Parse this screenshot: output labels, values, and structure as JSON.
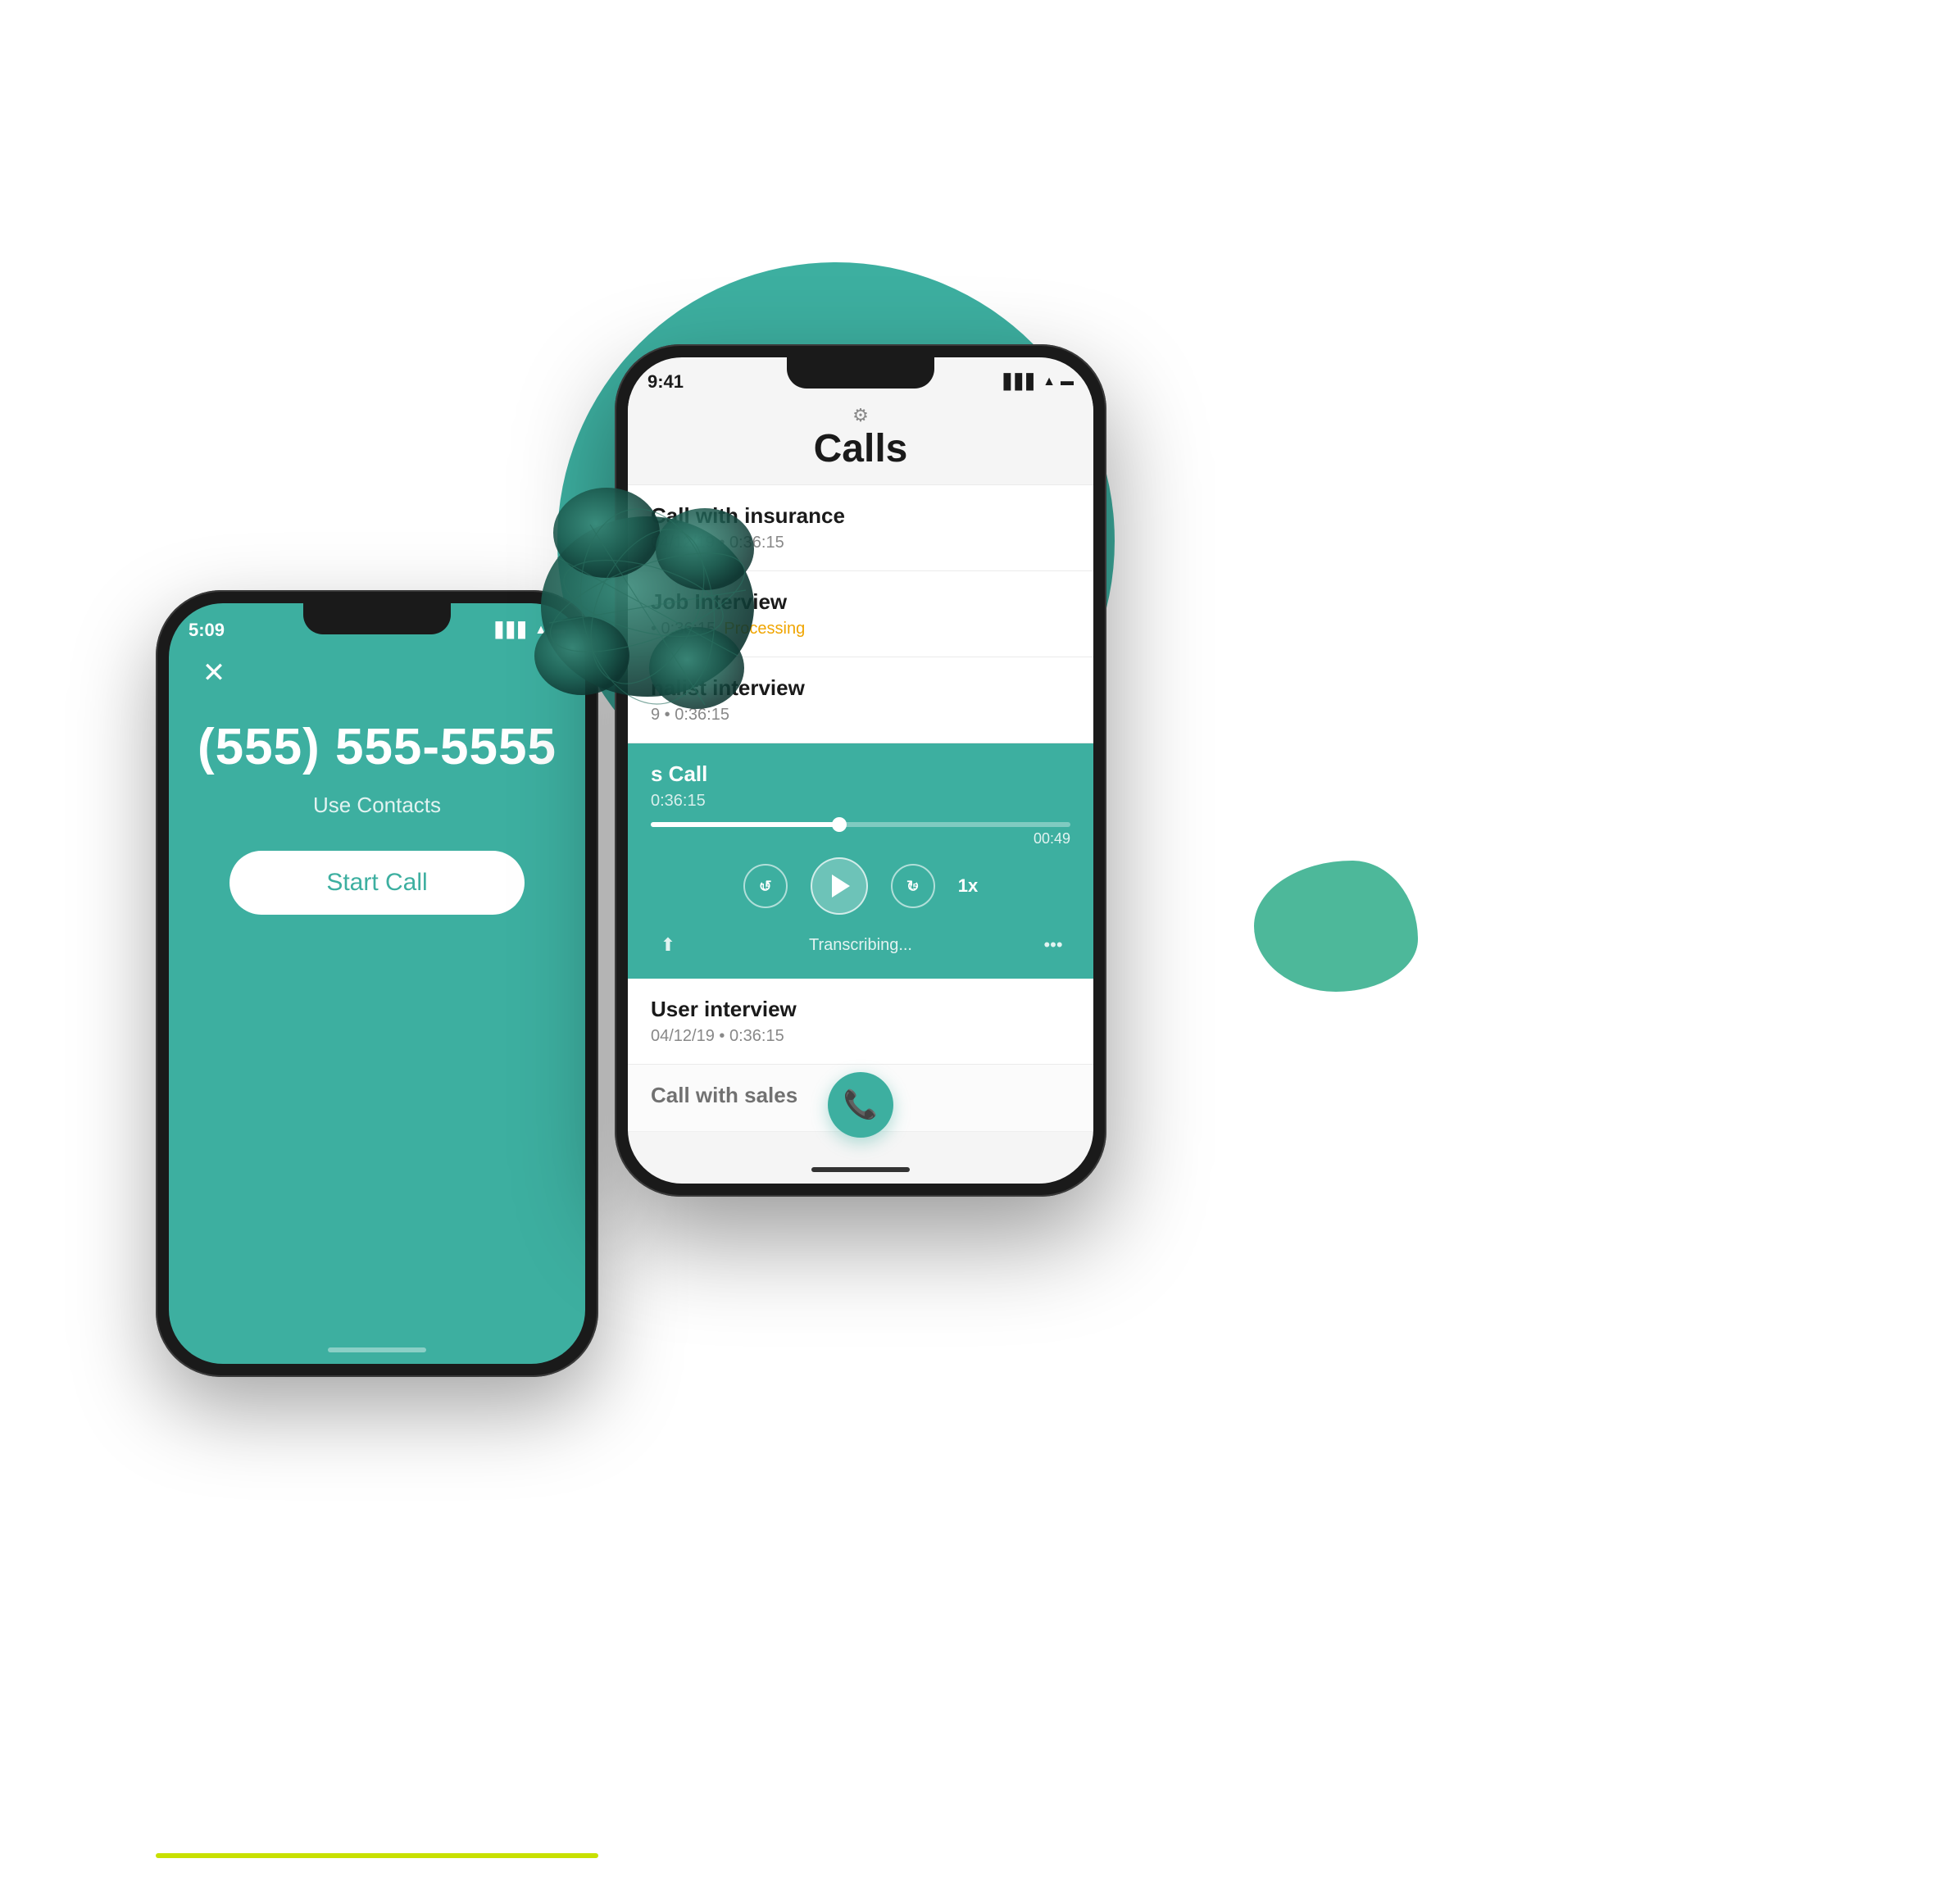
{
  "background": {
    "circle_color": "#3dafa0",
    "blob_small_color": "#4dba9c",
    "yellow_line_color": "#c8e000"
  },
  "phone_left": {
    "status_time": "5:09",
    "close_icon": "✕",
    "phone_number": "(555) 555-5555",
    "use_contacts": "Use Contacts",
    "start_call_btn": "Start Call",
    "screen_color": "#3dafa0"
  },
  "phone_right": {
    "status_time": "9:41",
    "page_title": "Calls",
    "gear_label": "⚙",
    "calls": [
      {
        "name": "Call with insurance",
        "meta": "04/12/19  •  0:36:15",
        "status": "",
        "active": false
      },
      {
        "name": "Job Interview",
        "meta": "•  0:36:15",
        "status": "Processing",
        "active": false
      },
      {
        "name": "Finalist interview",
        "meta": "9  •  0:36:15",
        "status": "",
        "active": false
      },
      {
        "name": "Sales Call",
        "meta": "0:36:15",
        "status": "",
        "active": true,
        "progress_time": "00:49",
        "transcribing_text": "Transcribing...",
        "speed": "1x"
      }
    ],
    "calls_below_active": [
      {
        "name": "User interview",
        "meta": "04/12/19  •  0:36:15",
        "status": "",
        "active": false
      },
      {
        "name": "Call with sales",
        "meta": "",
        "status": "",
        "active": false,
        "partial": true
      }
    ],
    "fab_icon": "☎"
  }
}
